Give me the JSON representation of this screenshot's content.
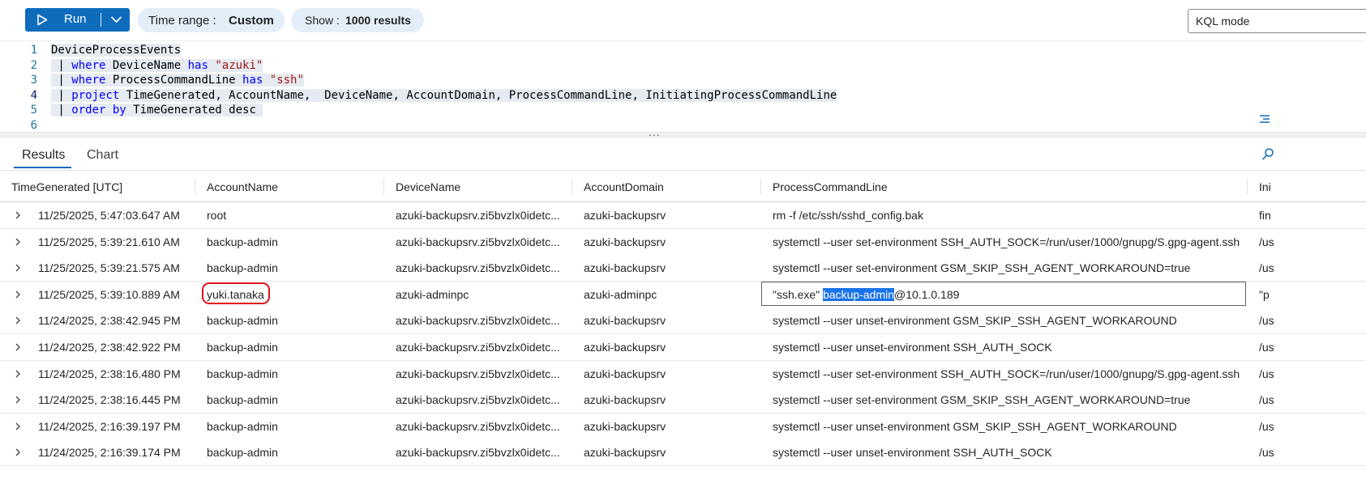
{
  "toolbar": {
    "run_label": "Run",
    "time_range_label": "Time range :",
    "time_range_value": "Custom",
    "show_label": "Show :",
    "show_value": "1000 results",
    "mode_label": "KQL mode"
  },
  "editor": {
    "line_numbers": [
      "1",
      "2",
      "3",
      "4",
      "5",
      "6"
    ],
    "lines": [
      [
        {
          "t": "DeviceProcessEvents",
          "c": "id"
        }
      ],
      [
        {
          "t": " | ",
          "c": "pipe"
        },
        {
          "t": "where",
          "c": "kw"
        },
        {
          "t": " DeviceName ",
          "c": "id"
        },
        {
          "t": "has",
          "c": "kw"
        },
        {
          "t": " ",
          "c": "id"
        },
        {
          "t": "\"azuki\"",
          "c": "str"
        }
      ],
      [
        {
          "t": " | ",
          "c": "pipe"
        },
        {
          "t": "where",
          "c": "kw"
        },
        {
          "t": " ProcessCommandLine ",
          "c": "id"
        },
        {
          "t": "has",
          "c": "kw"
        },
        {
          "t": " ",
          "c": "id"
        },
        {
          "t": "\"ssh\"",
          "c": "str"
        }
      ],
      [
        {
          "t": " | ",
          "c": "pipe"
        },
        {
          "t": "project",
          "c": "kw"
        },
        {
          "t": " TimeGenerated, AccountName,  DeviceName, AccountDomain, ProcessCommandLine, InitiatingProcessCommandLine",
          "c": "id"
        }
      ],
      [
        {
          "t": " | ",
          "c": "pipe"
        },
        {
          "t": "order by",
          "c": "kw"
        },
        {
          "t": " TimeGenerated desc ",
          "c": "id"
        }
      ],
      []
    ],
    "resize_handle": "..."
  },
  "results": {
    "tabs": [
      {
        "label": "Results",
        "active": true
      },
      {
        "label": "Chart",
        "active": false
      }
    ],
    "columns": [
      "TimeGenerated [UTC]",
      "AccountName",
      "DeviceName",
      "AccountDomain",
      "ProcessCommandLine",
      "Ini"
    ],
    "rows": [
      {
        "time": "11/25/2025, 5:47:03.647 AM",
        "account": "root",
        "device": "azuki-backupsrv.zi5bvzlx0idetc...",
        "domain": "azuki-backupsrv",
        "cmd": "rm -f /etc/ssh/sshd_config.bak",
        "init": "fin"
      },
      {
        "time": "11/25/2025, 5:39:21.610 AM",
        "account": "backup-admin",
        "device": "azuki-backupsrv.zi5bvzlx0idetc...",
        "domain": "azuki-backupsrv",
        "cmd": "systemctl --user set-environment SSH_AUTH_SOCK=/run/user/1000/gnupg/S.gpg-agent.ssh",
        "init": "/us"
      },
      {
        "time": "11/25/2025, 5:39:21.575 AM",
        "account": "backup-admin",
        "device": "azuki-backupsrv.zi5bvzlx0idetc...",
        "domain": "azuki-backupsrv",
        "cmd": "systemctl --user set-environment GSM_SKIP_SSH_AGENT_WORKAROUND=true",
        "init": "/us"
      },
      {
        "time": "11/25/2025, 5:39:10.889 AM",
        "account": "yuki.tanaka",
        "device": "azuki-adminpc",
        "domain": "azuki-adminpc",
        "cmd_pre": "\"ssh.exe\" ",
        "cmd_hl": "backup-admin",
        "cmd_post": "@10.1.0.189",
        "init": "\"p"
      },
      {
        "time": "11/24/2025, 2:38:42.945 PM",
        "account": "backup-admin",
        "device": "azuki-backupsrv.zi5bvzlx0idetc...",
        "domain": "azuki-backupsrv",
        "cmd": "systemctl --user unset-environment GSM_SKIP_SSH_AGENT_WORKAROUND",
        "init": "/us"
      },
      {
        "time": "11/24/2025, 2:38:42.922 PM",
        "account": "backup-admin",
        "device": "azuki-backupsrv.zi5bvzlx0idetc...",
        "domain": "azuki-backupsrv",
        "cmd": "systemctl --user unset-environment SSH_AUTH_SOCK",
        "init": "/us"
      },
      {
        "time": "11/24/2025, 2:38:16.480 PM",
        "account": "backup-admin",
        "device": "azuki-backupsrv.zi5bvzlx0idetc...",
        "domain": "azuki-backupsrv",
        "cmd": "systemctl --user set-environment SSH_AUTH_SOCK=/run/user/1000/gnupg/S.gpg-agent.ssh",
        "init": "/us"
      },
      {
        "time": "11/24/2025, 2:38:16.445 PM",
        "account": "backup-admin",
        "device": "azuki-backupsrv.zi5bvzlx0idetc...",
        "domain": "azuki-backupsrv",
        "cmd": "systemctl --user set-environment GSM_SKIP_SSH_AGENT_WORKAROUND=true",
        "init": "/us"
      },
      {
        "time": "11/24/2025, 2:16:39.197 PM",
        "account": "backup-admin",
        "device": "azuki-backupsrv.zi5bvzlx0idetc...",
        "domain": "azuki-backupsrv",
        "cmd": "systemctl --user unset-environment GSM_SKIP_SSH_AGENT_WORKAROUND",
        "init": "/us"
      },
      {
        "time": "11/24/2025, 2:16:39.174 PM",
        "account": "backup-admin",
        "device": "azuki-backupsrv.zi5bvzlx0idetc...",
        "domain": "azuki-backupsrv",
        "cmd": "systemctl --user unset-environment SSH_AUTH_SOCK",
        "init": "/us"
      }
    ]
  },
  "colors": {
    "accent": "#0f6cbd",
    "pill_bg": "#e3eef8",
    "keyword": "#0000ff",
    "string": "#a31515",
    "selection_highlight": "#1a73e8",
    "annotation_circle": "#e0101a"
  },
  "icons": {
    "run": "play-icon",
    "run_menu": "chevron-down-icon",
    "row_expand": "chevron-right-icon",
    "format": "format-lines-icon",
    "search": "search-icon"
  }
}
